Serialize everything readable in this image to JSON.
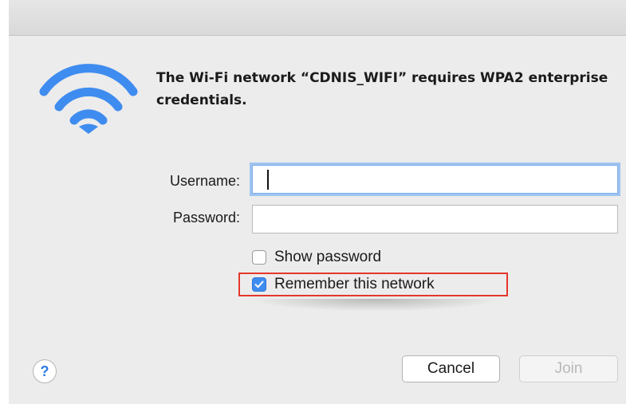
{
  "dialog": {
    "message": "The Wi-Fi network “CDNIS_WIFI” requires WPA2 enterprise credentials.",
    "icon": "wifi-icon",
    "accent_color": "#3f8cf0"
  },
  "form": {
    "username": {
      "label": "Username:",
      "value": "",
      "focused": true
    },
    "password": {
      "label": "Password:",
      "value": ""
    }
  },
  "options": {
    "show_password": {
      "label": "Show password",
      "checked": false
    },
    "remember_network": {
      "label": "Remember this network",
      "checked": true,
      "highlight_color": "#e5372c"
    }
  },
  "buttons": {
    "help": "?",
    "cancel": "Cancel",
    "join": "Join",
    "join_enabled": false
  }
}
